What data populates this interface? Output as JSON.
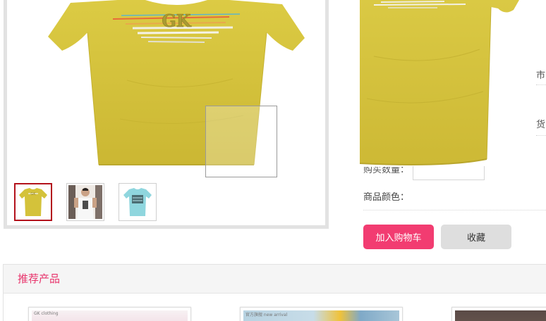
{
  "product": {
    "print_text": "GK",
    "thumbnails": [
      {
        "name": "yellow-tshirt",
        "active": true
      },
      {
        "name": "model-photo",
        "active": false
      },
      {
        "name": "blue-tshirt",
        "active": false
      }
    ]
  },
  "details": {
    "market_price_fragment": "市",
    "stock_fragment": "货",
    "quantity_label": "购买数量：",
    "color_label": "商品颜色："
  },
  "actions": {
    "add_to_cart": "加入购物车",
    "favorite": "收藏"
  },
  "recommended": {
    "title": "推荐产品",
    "cards": [
      {
        "tag": "GK clothing"
      },
      {
        "tag": "官方旗舰 new arrival"
      },
      {
        "tag": ""
      }
    ]
  },
  "colors": {
    "shirt": "#d4c23a",
    "accent": "#f23c71",
    "rec_title": "#e8336b",
    "active_thumb_border": "#b3121c"
  }
}
